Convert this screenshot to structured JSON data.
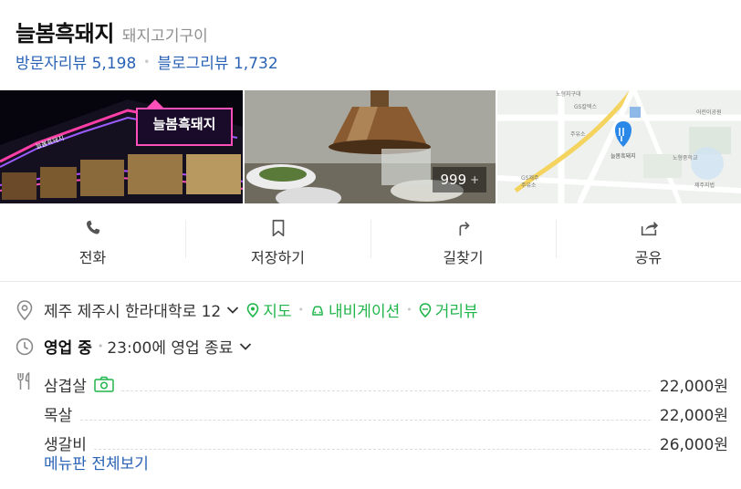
{
  "header": {
    "name": "늘봄흑돼지",
    "category": "돼지고기구이"
  },
  "reviews": {
    "visitor_label": "방문자리뷰",
    "visitor_count": "5,198",
    "blog_label": "블로그리뷰",
    "blog_count": "1,732"
  },
  "photos": {
    "count": "999",
    "count_plus": "+",
    "sign_main": "늘봄흑돼지",
    "sign_small": "늘봄흑돼지",
    "map_labels": [
      "노형지구대",
      "GS칼텍스",
      "주유소",
      "GS제주",
      "주유소",
      "늘봄흑돼지",
      "노형중학교",
      "제주지법",
      "어린이공원"
    ]
  },
  "actions": [
    {
      "label": "전화",
      "icon": "phone-icon"
    },
    {
      "label": "저장하기",
      "icon": "bookmark-icon"
    },
    {
      "label": "길찾기",
      "icon": "directions-icon"
    },
    {
      "label": "공유",
      "icon": "share-icon"
    }
  ],
  "address": {
    "text": "제주 제주시 한라대학로 12",
    "map_label": "지도",
    "navi_label": "내비게이션",
    "street_label": "거리뷰"
  },
  "hours": {
    "status": "영업 중",
    "close_text": "23:00에 영업 종료"
  },
  "menu": {
    "items": [
      {
        "name": "삼겹살",
        "price": "22,000원",
        "has_photo": true
      },
      {
        "name": "목살",
        "price": "22,000원",
        "has_photo": false
      },
      {
        "name": "생갈비",
        "price": "26,000원",
        "has_photo": false
      }
    ],
    "view_all": "메뉴판 전체보기"
  },
  "colors": {
    "link_blue": "#2a63b5",
    "green": "#21b64b",
    "map_pin": "#2a88e8"
  }
}
